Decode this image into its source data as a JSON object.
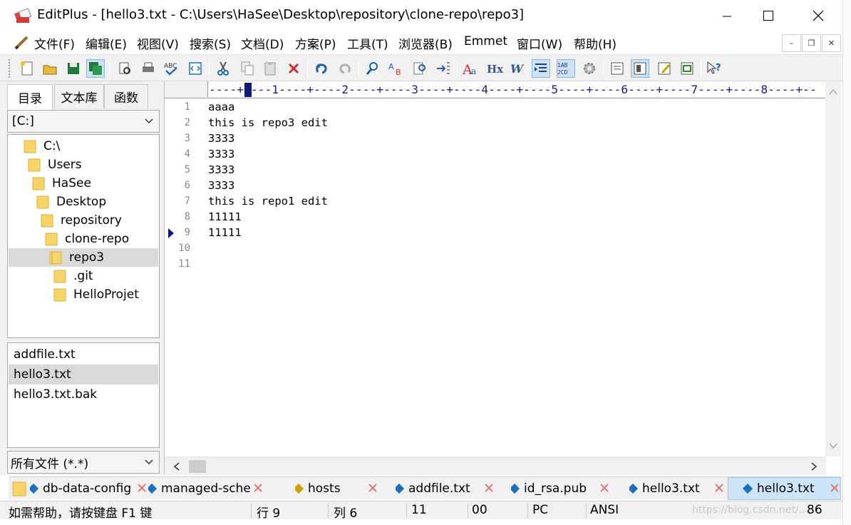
{
  "window": {
    "title": "EditPlus - [hello3.txt - C:\\Users\\HaSee\\Desktop\\repository\\clone-repo\\repo3]"
  },
  "menubar": {
    "items": [
      "文件(F)",
      "编辑(E)",
      "视图(V)",
      "搜索(S)",
      "文档(D)",
      "方案(P)",
      "工具(T)",
      "浏览器(B)",
      "Emmet",
      "窗口(W)",
      "帮助(H)"
    ]
  },
  "toolbar": {
    "buttons": [
      "new-file",
      "open-file",
      "save",
      "save-all",
      "print-preview",
      "print",
      "spell-check",
      "html-preview",
      "cut",
      "copy",
      "paste",
      "delete",
      "undo",
      "redo",
      "find",
      "replace",
      "find-in-files",
      "goto-line",
      "font",
      "hex",
      "word-wrap",
      "indent",
      "line-numbers",
      "settings",
      "directory-window",
      "output-window",
      "cliptext",
      "fullscreen",
      "context-help"
    ]
  },
  "sidebar": {
    "tabs": [
      "目录",
      "文本库",
      "函数"
    ],
    "drive": "[C:]",
    "tree": [
      "C:\\",
      "Users",
      "HaSee",
      "Desktop",
      "repository",
      "clone-repo",
      "repo3",
      ".git",
      "HelloProjet"
    ],
    "selected_folder": "repo3",
    "files": [
      "addfile.txt",
      "hello3.txt",
      "hello3.txt.bak"
    ],
    "selected_file": "hello3.txt",
    "filter": "所有文件 (*.*)"
  },
  "editor": {
    "ruler": "----+----1----+----2----+----3----+----4----+----5----+----6----+----7----+----8----+--",
    "line_numbers": [
      "1",
      "2",
      "3",
      "4",
      "5",
      "6",
      "7",
      "8",
      "9",
      "10",
      "11"
    ],
    "lines": [
      "aaaa",
      "this is repo3 edit",
      "3333",
      "3333",
      "3333",
      "3333",
      "this is repo1 edit",
      "11111",
      "11111",
      "",
      ""
    ],
    "current_line": 9
  },
  "document_tabs": [
    {
      "label": "db-data-config",
      "color": "#1e6fbf"
    },
    {
      "label": "managed-sche",
      "color": "#1e6fbf"
    },
    {
      "label": "hosts",
      "color": "#c8a000"
    },
    {
      "label": "addfile.txt",
      "color": "#1e6fbf"
    },
    {
      "label": "id_rsa.pub",
      "color": "#1e6fbf"
    },
    {
      "label": "hello3.txt",
      "color": "#1e6fbf"
    },
    {
      "label": "hello3.txt",
      "color": "#1e6fbf",
      "active": true
    }
  ],
  "statusbar": {
    "help": "如需帮助，请按键盘 F1 键",
    "line": "行 9",
    "col": "列 6",
    "total_lines": "11",
    "code": "00",
    "format": "PC",
    "encoding": "ANSI",
    "size": "86",
    "watermark": "https://blog.csdn.net/..."
  },
  "colors": {
    "selection": "#d9d9d9",
    "active_tab": "#cce4f7",
    "ruler_cursor": "#111a7a",
    "close_red": "#d9534f"
  }
}
